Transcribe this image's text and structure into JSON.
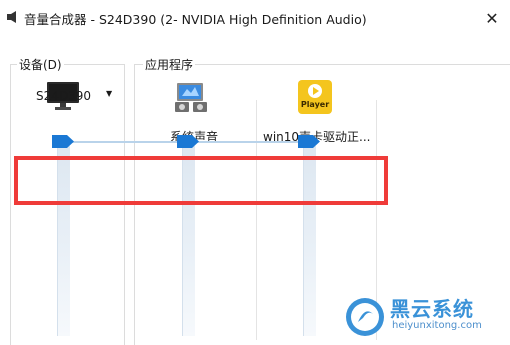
{
  "window": {
    "title": "音量合成器 - S24D390 (2- NVIDIA High Definition Audio)",
    "close_glyph": "✕"
  },
  "device_section": {
    "label": "设备(D)",
    "device_name": "S24D390",
    "dropdown_glyph": "▼",
    "volume": 1.0
  },
  "apps_section": {
    "label": "应用程序",
    "apps": [
      {
        "label": "系统声音",
        "icon": "system-sounds-icon",
        "volume": 1.0
      },
      {
        "label": "win10声卡驱动正...",
        "icon": "player-app-icon",
        "volume": 1.0
      }
    ]
  },
  "player_icon_text": "Player",
  "watermark": {
    "title": "黑云系统",
    "url": "heiyunxitong.com"
  },
  "colors": {
    "highlight": "#ef3b39",
    "thumb": "#1a78d4",
    "player_icon": "#f4c51e",
    "watermark": "#3a92d8"
  }
}
